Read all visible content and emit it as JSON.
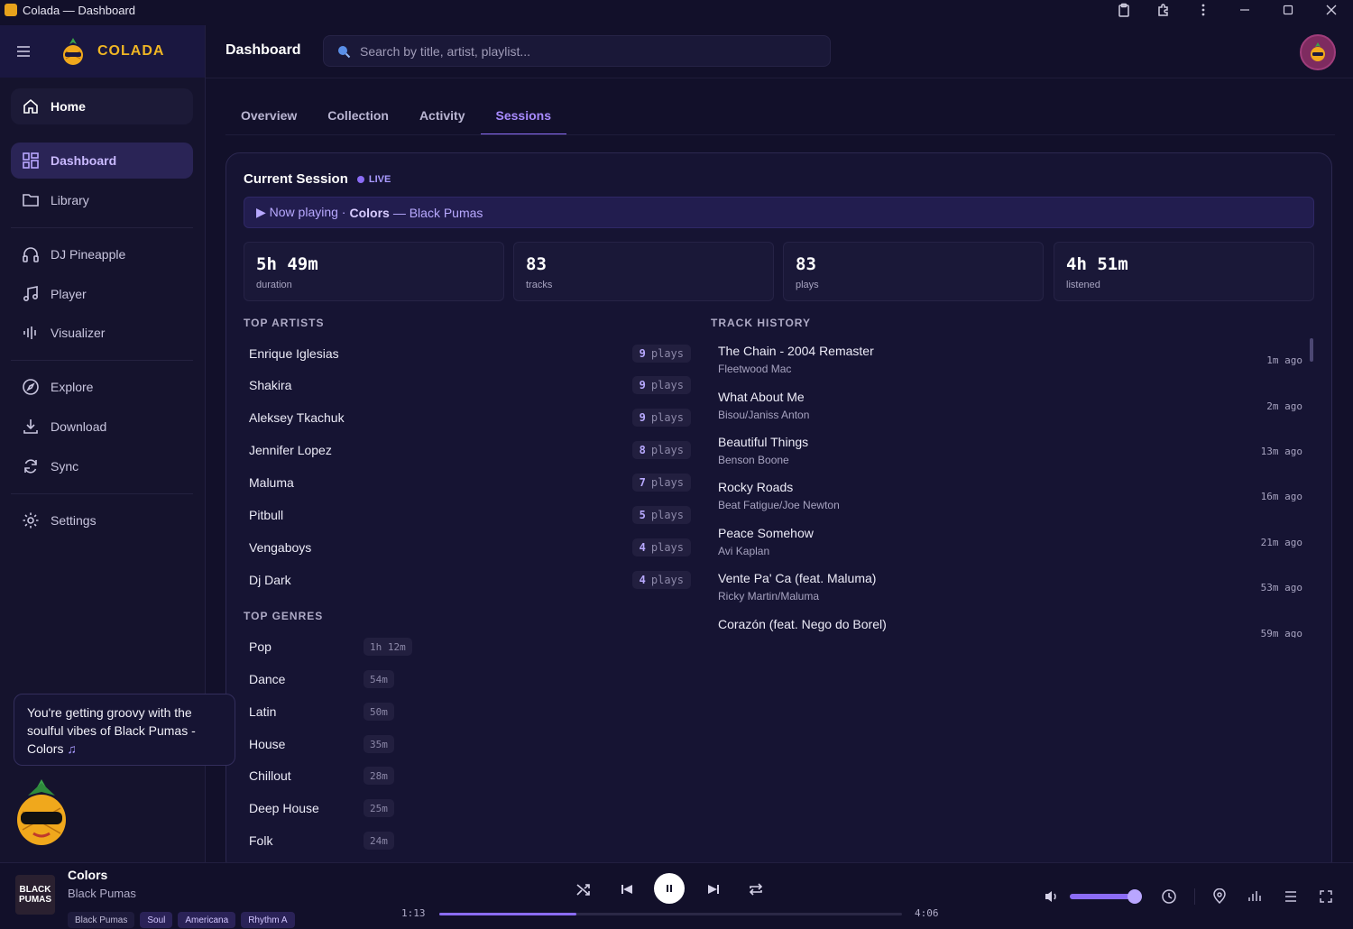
{
  "window": {
    "title": "Colada — Dashboard"
  },
  "brand": {
    "name": "COLADA"
  },
  "sidebar": {
    "items": [
      {
        "label": "Home",
        "icon": "home-icon"
      },
      {
        "label": "Dashboard",
        "icon": "dashboard-icon"
      },
      {
        "label": "Library",
        "icon": "folder-icon"
      },
      {
        "label": "DJ Pineapple",
        "icon": "headphones-icon"
      },
      {
        "label": "Player",
        "icon": "music-note-icon"
      },
      {
        "label": "Visualizer",
        "icon": "equalizer-icon"
      },
      {
        "label": "Explore",
        "icon": "compass-icon"
      },
      {
        "label": "Download",
        "icon": "download-icon"
      },
      {
        "label": "Sync",
        "icon": "sync-icon"
      },
      {
        "label": "Settings",
        "icon": "gear-icon"
      }
    ]
  },
  "header": {
    "title": "Dashboard",
    "search_placeholder": "Search by title, artist, playlist..."
  },
  "tabs": [
    {
      "label": "Overview"
    },
    {
      "label": "Collection"
    },
    {
      "label": "Activity"
    },
    {
      "label": "Sessions"
    }
  ],
  "session": {
    "title": "Current Session",
    "live": "LIVE",
    "now_playing_prefix": "▶ Now playing ·",
    "now_playing_title": "Colors",
    "now_playing_suffix": "— Black Pumas",
    "stats": [
      {
        "value": "5h 49m",
        "label": "duration"
      },
      {
        "value": "83",
        "label": "tracks"
      },
      {
        "value": "83",
        "label": "plays"
      },
      {
        "value": "4h 51m",
        "label": "listened"
      }
    ]
  },
  "top_artists": {
    "heading": "TOP ARTISTS",
    "plays_word": "plays",
    "rows": [
      {
        "name": "Enrique Iglesias",
        "count": "9"
      },
      {
        "name": "Shakira",
        "count": "9"
      },
      {
        "name": "Aleksey Tkachuk",
        "count": "9"
      },
      {
        "name": "Jennifer Lopez",
        "count": "8"
      },
      {
        "name": "Maluma",
        "count": "7"
      },
      {
        "name": "Pitbull",
        "count": "5"
      },
      {
        "name": "Vengaboys",
        "count": "4"
      },
      {
        "name": "Dj Dark",
        "count": "4"
      }
    ]
  },
  "top_genres": {
    "heading": "TOP GENRES",
    "rows": [
      {
        "name": "Pop",
        "duration": "1h 12m"
      },
      {
        "name": "Dance",
        "duration": "54m"
      },
      {
        "name": "Latin",
        "duration": "50m"
      },
      {
        "name": "House",
        "duration": "35m"
      },
      {
        "name": "Chillout",
        "duration": "28m"
      },
      {
        "name": "Deep House",
        "duration": "25m"
      },
      {
        "name": "Folk",
        "duration": "24m"
      }
    ]
  },
  "track_history": {
    "heading": "TRACK HISTORY",
    "rows": [
      {
        "title": "The Chain - 2004 Remaster",
        "artist": "Fleetwood Mac",
        "ago": "1m ago"
      },
      {
        "title": "What About Me",
        "artist": "Bisou/Janiss Anton",
        "ago": "2m ago"
      },
      {
        "title": "Beautiful Things",
        "artist": "Benson Boone",
        "ago": "13m ago"
      },
      {
        "title": "Rocky Roads",
        "artist": "Beat Fatigue/Joe Newton",
        "ago": "16m ago"
      },
      {
        "title": "Peace Somehow",
        "artist": "Avi Kaplan",
        "ago": "21m ago"
      },
      {
        "title": "Vente Pa' Ca (feat. Maluma)",
        "artist": "Ricky Martin/Maluma",
        "ago": "53m ago"
      },
      {
        "title": "Corazón (feat. Nego do Borel)",
        "artist": "",
        "ago": "59m ago"
      }
    ]
  },
  "toast": {
    "message": "You're getting groovy with the soulful vibes of Black Pumas - Colors",
    "note_icon": "♫"
  },
  "player": {
    "cover_text": [
      "BLACK",
      "PUMAS"
    ],
    "title": "Colors",
    "artist": "Black Pumas",
    "tags": [
      "Black Pumas",
      "Soul",
      "Americana",
      "Rhythm A"
    ],
    "time_current": "1:13",
    "time_total": "4:06",
    "progress_fraction": 0.297,
    "volume_fraction": 0.95
  },
  "colors": {
    "accent": "#8b6cf6",
    "brand": "#f0b624",
    "background": "#12102a"
  }
}
